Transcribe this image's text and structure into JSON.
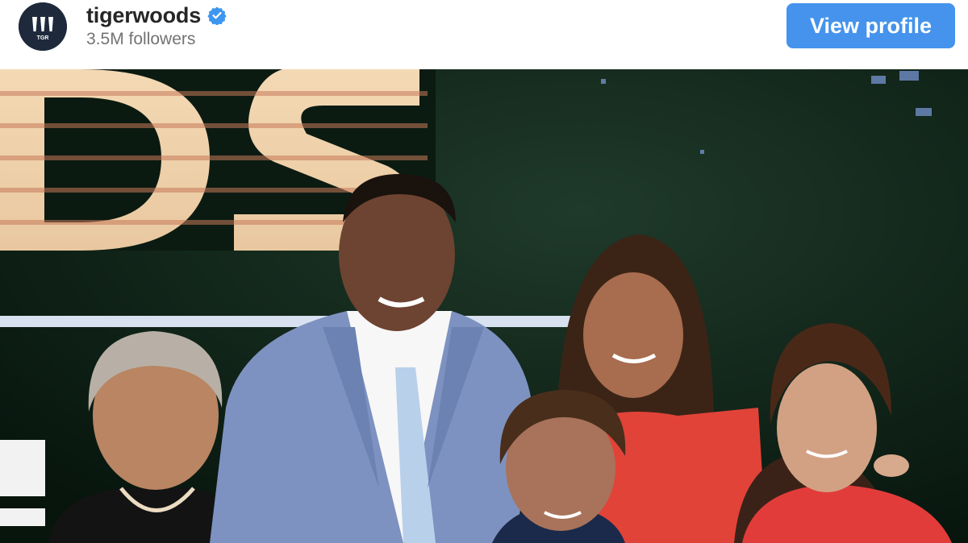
{
  "profile": {
    "username": "tigerwoods",
    "followers": "3.5M followers",
    "avatar_text": "TGR",
    "verified": true
  },
  "actions": {
    "view_profile": "View profile"
  },
  "colors": {
    "button": "#4593ec",
    "verified_badge": "#3d97f0",
    "avatar_bg": "#1e2a3b"
  },
  "icons": {
    "verified": "verified-badge-icon",
    "avatar": "tgr-logo-icon"
  }
}
